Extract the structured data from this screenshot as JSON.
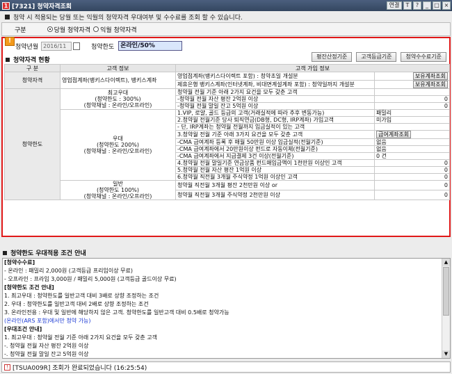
{
  "titlebar": {
    "title": "[7321] 청약자격조회",
    "link_label": "연결",
    "controls": [
      "T",
      "?",
      "_",
      "□",
      "×"
    ]
  },
  "info": {
    "text": "청약 시 적용되는 당월 또는 익월의 청약자격 우대여부 및 수수료를 조회 할 수 있습니다."
  },
  "gubun": {
    "label": "구분",
    "options": [
      "당월 청약자격",
      "익월 청약자격"
    ],
    "selected_index": 0
  },
  "query": {
    "date_label": "청약년월",
    "date_value": "2016/11",
    "limit_label": "청약한도",
    "limit_value": "온라인/50%"
  },
  "section1": {
    "title": "청약자격 현황",
    "buttons": [
      "평잔산정기준",
      "고객등급기준",
      "청약수수료기준"
    ]
  },
  "table": {
    "headers": [
      "구  분",
      "고객  정보",
      "고객 가입 정보"
    ],
    "qual_label": "청약자격",
    "qual_customer": "영업점계좌(뱅키스다이렉트), 뱅키스계좌",
    "qual_rows": [
      {
        "text": "영업점계좌(뱅키스다이렉트 포함)       : 청약초일 개설분",
        "btn": "보유계좌조회"
      },
      {
        "text": "제휴은행 뱅키스계좌(인터넷계좌, 비대면계설계좌 포함) : 청약일까지 개설분",
        "btn": "보유계좌조회"
      }
    ],
    "limit_label": "청약한도",
    "groups": [
      {
        "name": "최고우대",
        "lines": [
          "(청약한도 : 300%)",
          "(청약채널 : 온라인/오프라인)"
        ]
      },
      {
        "name": "우대",
        "lines": [
          "(청약한도 200%)",
          "(청약채널 : 온라인/오프라인)"
        ]
      },
      {
        "name": "일반",
        "lines": [
          "(청약한도 100%)",
          "(청약채널 : 온라인/오프라인)"
        ]
      }
    ],
    "top_rows": [
      {
        "text": "청약월 전월 기준 아래 2가지 요건을 모두 갖춘 고객",
        "value": ""
      },
      {
        "text": " -청약월 전월 자산 평잔 2억원 이상",
        "value": "0"
      },
      {
        "text": " -청약월 전월 말일 잔고 5억원 이상",
        "value": "0"
      }
    ],
    "mid_rows": [
      {
        "text": "1.VIP, 로얄, 골드 등급의 고객(거래실적에 따라 추후 변동가능)",
        "value": "패밀리"
      },
      {
        "text": "2.청약월 전월기준 당사 퇴직연금(DB형, DC형, IRP계좌) 가입고객",
        "value": "미가입"
      },
      {
        "text": "  - 단, IRP계좌는 청약월 전월까지 입금실적이 있는 고객",
        "value": ""
      },
      {
        "text": "3.청약월 전월 기준 아래 3가지 요건을 모두 갖춘 고객",
        "value": "",
        "btn": "급여계좌조회"
      },
      {
        "text": " -CMA 급여계좌 등록 후 매월 50만원 이상 입금실적(전월기준)",
        "value": "없음"
      },
      {
        "text": " -CMA 급여계좌에서 20만원이상 펀드로 자동이체(전월기준)",
        "value": "없음"
      },
      {
        "text": " -CMA 급여계좌에서 지급결제 3건 이상(전월기준)",
        "value": "0 건"
      },
      {
        "text": "4.청약월 전월 말일기준 연금상품 펀드매입금액이 1천만원 이상인 고객",
        "value": "0"
      },
      {
        "text": "5.청약월 전월 자산 평잔 1억원 이상",
        "value": "0"
      },
      {
        "text": "6.청약월 직전월 3개월 주식약정 1억원 이상인 고객",
        "value": "0"
      }
    ],
    "bot_rows": [
      {
        "text": "청약월 직전월 3개월 평잔 2천만원 이상 or",
        "value": "0"
      },
      {
        "text": "청약월 직전월 3개월 주식약정 2천만원 이상",
        "value": "0"
      }
    ]
  },
  "section2": {
    "title": "청약한도 우대적용 조건 안내"
  },
  "guide": [
    {
      "t": "[청약수수료]",
      "c": "h"
    },
    {
      "t": "- 온라인 : 패밀리 2,000원 (고객등급 프리임이상 무료)",
      "c": ""
    },
    {
      "t": "- 오프라인 : 프라임 3,000원 / 패밀리 5,000원 (고객등급 골드이상 무료)",
      "c": ""
    },
    {
      "t": "[청약한도 조건 안내]",
      "c": "h"
    },
    {
      "t": "1. 최고우대 : 청약한도를 일반고객 대비 3배로 상향 조정하는 조건",
      "c": ""
    },
    {
      "t": "2. 우대 : 청약한도를 일반고객 대비 2배로 상향 조정하는 조건",
      "c": ""
    },
    {
      "t": "3. 온라인전용 : 우대 및 일반에 해당하지 않은 고객. 청약한도를 일반고객 대비 0.5배로 청약가능",
      "c": ""
    },
    {
      "t": "            (온라인(ARS 포함)에서만 청약 가능)",
      "c": "blue"
    },
    {
      "t": "[우대조건 안내]",
      "c": "h"
    },
    {
      "t": "1. 최고우대 : 청약월 전월 기준 아래 2가지 요건을 모두 갖춘 고객",
      "c": ""
    },
    {
      "t": "   -. 청약월 전월 자산 평잔 2억원 이상",
      "c": ""
    },
    {
      "t": "   -. 청약월 전월 말일 잔고 5억원 이상",
      "c": ""
    }
  ],
  "status": {
    "text": "[TSUA009R] 조회가 완료되었습니다 (16:25:54)"
  }
}
